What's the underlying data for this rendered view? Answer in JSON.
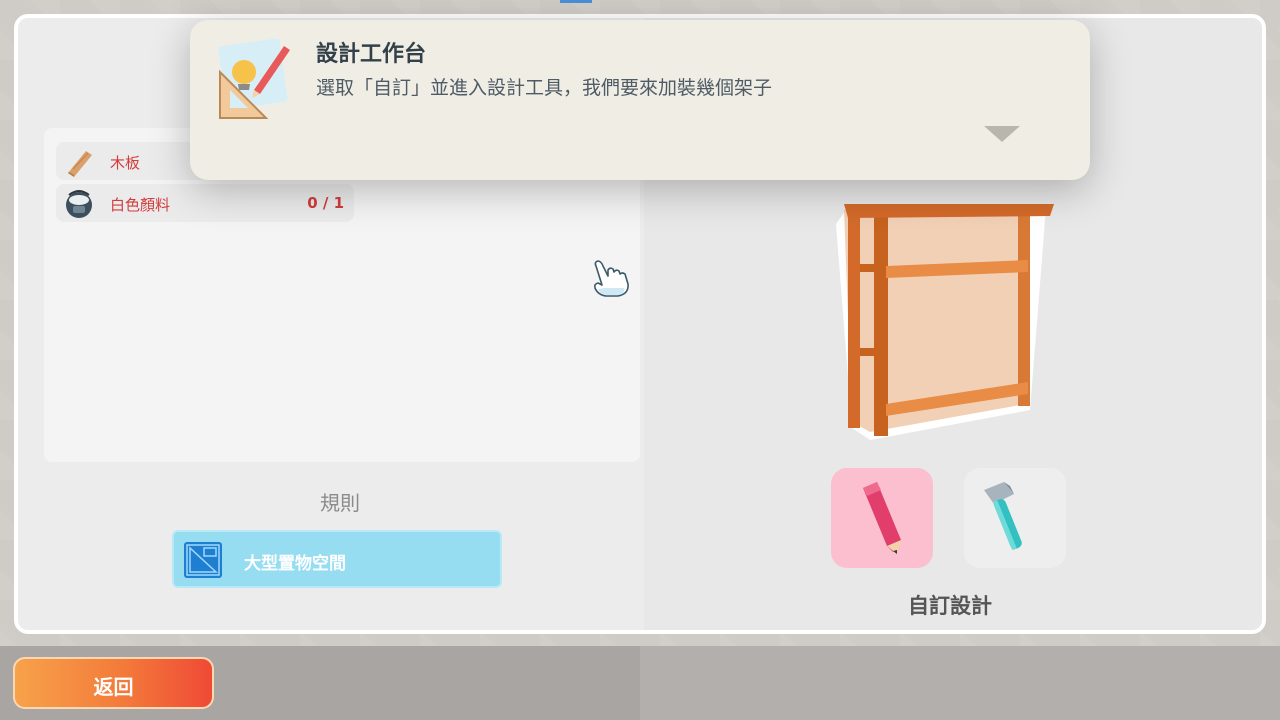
{
  "tooltip": {
    "title": "設計工作台",
    "message": "選取「自訂」並進入設計工具，我們要來加裝幾個架子",
    "icon": "design-tools-icon",
    "expand_icon": "chevron-down-icon"
  },
  "materials": [
    {
      "name": "木板",
      "count": "",
      "icon": "wood-plank-icon"
    },
    {
      "name": "白色顏料",
      "count": "0 / 1",
      "icon": "paint-bucket-icon"
    }
  ],
  "rules": {
    "label": "規則",
    "items": [
      {
        "text": "大型置物空間",
        "icon": "blueprint-icon"
      }
    ]
  },
  "modes": {
    "custom_icon": "pencil-icon",
    "build_icon": "hammer-icon",
    "selected_label": "自訂設計"
  },
  "back_button": {
    "label": "返回"
  },
  "colors": {
    "tooltip_bg": "#f0eee4",
    "material_text": "#d23c3c",
    "rule_bg": "#96ddf2",
    "custom_mode_bg": "#fbbfcf",
    "back_button_start": "#f7a24a",
    "back_button_end": "#ef4a36"
  }
}
